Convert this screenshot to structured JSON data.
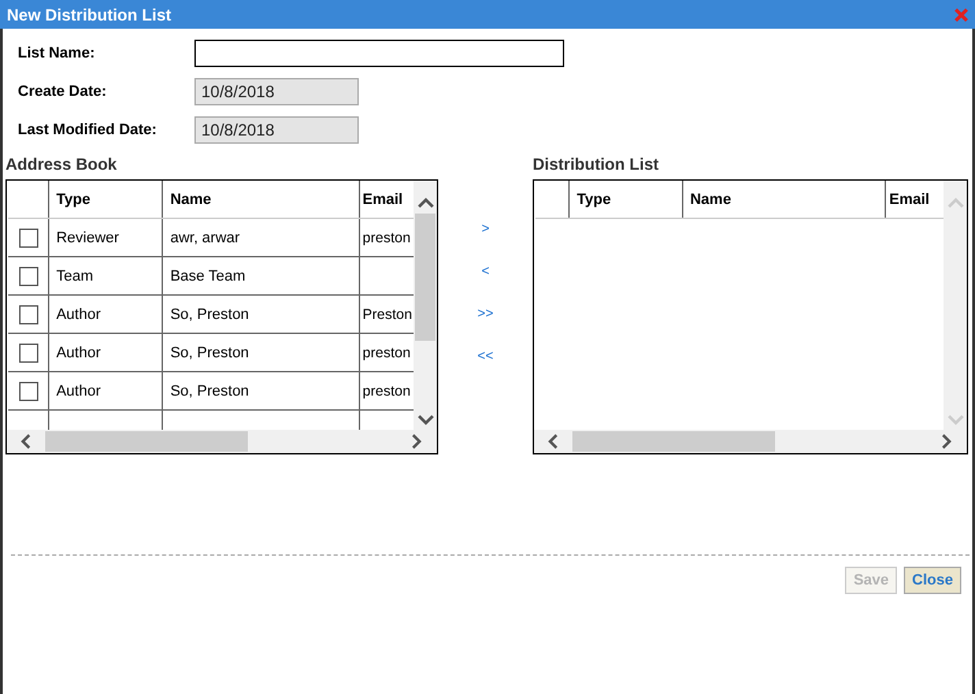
{
  "window": {
    "title": "New Distribution List"
  },
  "fields": [
    {
      "label": "List Name:",
      "kind": "input"
    },
    {
      "label": "Create Date:",
      "value": "10/8/2018",
      "kind": "readonly"
    },
    {
      "label": "Last Modified Date:",
      "value": "10/8/2018",
      "kind": "readonly"
    }
  ],
  "address_book": {
    "title": "Address Book",
    "columns": [
      "Type",
      "Name",
      "Email"
    ],
    "rows": [
      {
        "type": "Reviewer",
        "name": "awr, arwar",
        "email": "preston",
        "checked": false
      },
      {
        "type": "Team",
        "name": "Base Team",
        "email": "",
        "checked": false
      },
      {
        "type": "Author",
        "name": "So, Preston",
        "email": "Preston",
        "checked": false
      },
      {
        "type": "Author",
        "name": "So, Preston",
        "email": "preston",
        "checked": false
      },
      {
        "type": "Author",
        "name": "So, Preston",
        "email": "preston",
        "checked": false
      }
    ]
  },
  "move_buttons": [
    ">",
    "<",
    ">>",
    "<<"
  ],
  "distribution_list": {
    "title": "Distribution List",
    "columns": [
      "Type",
      "Name",
      "Email"
    ]
  },
  "buttons": [
    {
      "label": "Save",
      "disabled": true
    },
    {
      "label": "Close",
      "disabled": false
    }
  ]
}
